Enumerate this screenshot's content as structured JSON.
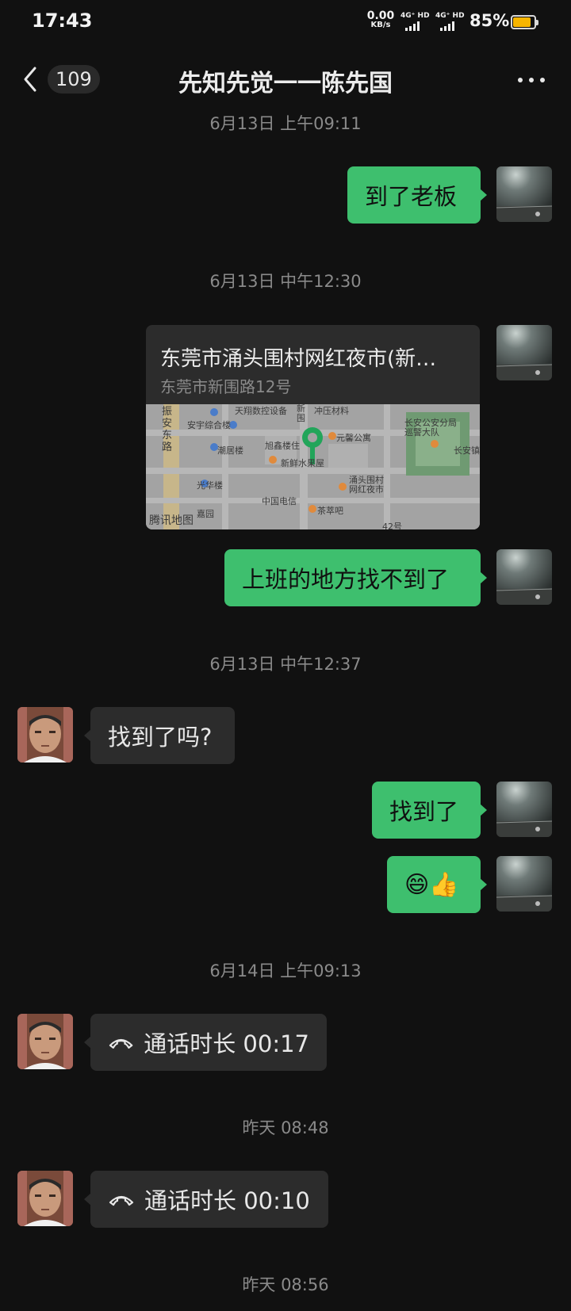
{
  "status_bar": {
    "time": "17:43",
    "net_speed_value": "0.00",
    "net_speed_unit": "KB/s",
    "signal1_label": "4G⁺ HD",
    "signal2_label": "4G⁺ HD",
    "battery_percent": "85%",
    "battery_level": 0.85,
    "battery_color": "#f7b500"
  },
  "header": {
    "unread_count": "109",
    "title": "先知先觉一一陈先国"
  },
  "messages": {
    "t1": "6月13日 上午09:11",
    "m1": "到了老板",
    "t2": "6月13日 中午12:30",
    "location": {
      "title": "东莞市涌头围村网红夜市(新…",
      "address": "东莞市新围路12号",
      "map_labels": {
        "l1": "天翔数控设备",
        "l2": "冲压材料",
        "l3": "安宇综合楼",
        "l4": "振安东路",
        "l5": "潮居楼",
        "l6": "旭鑫楼住",
        "l7": "元馨公寓",
        "l8": "长安公安分局\n巡警大队",
        "l9": "长安镇",
        "l10": "光华楼",
        "l11": "新鲜水果屋",
        "l12": "涌头围村\n网红夜市",
        "l13": "中国电信",
        "l14": "茶萃吧",
        "l15": "新围",
        "l16": "嘉园",
        "l17": "42号"
      },
      "map_brand": "腾讯地图"
    },
    "m2": "上班的地方找不到了",
    "t3": "6月13日 中午12:37",
    "m3": "找到了吗?",
    "m4": "找到了",
    "m5": "😄👍",
    "t4": "6月14日 上午09:13",
    "call1": "通话时长 00:17",
    "t5": "昨天 08:48",
    "call2": "通话时长 00:10",
    "t6": "昨天 08:56"
  },
  "colors": {
    "outgoing_bubble": "#3ebf6e",
    "incoming_bubble": "#2c2c2c",
    "background": "#111111"
  },
  "icons": [
    "back-chevron-icon",
    "more-dots-icon",
    "phone-hangup-icon",
    "map-pin-icon",
    "avatar"
  ]
}
